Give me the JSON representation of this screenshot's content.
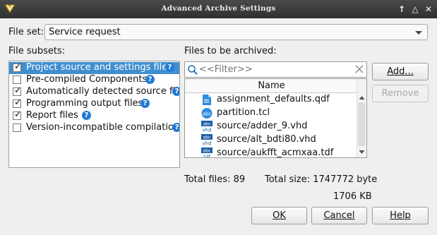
{
  "window": {
    "title": "Advanced Archive Settings"
  },
  "file_set": {
    "label": "File set:",
    "value": "Service request"
  },
  "subsets": {
    "label": "File subsets:",
    "items": [
      {
        "label": "Project source and settings files",
        "checked": true,
        "selected": true,
        "help": "?"
      },
      {
        "label": "Pre-compiled Components",
        "checked": false,
        "help": "?"
      },
      {
        "label": "Automatically detected source file",
        "checked": true,
        "help": "?"
      },
      {
        "label": "Programming output files",
        "checked": true,
        "help": "?"
      },
      {
        "label": "Report files",
        "checked": true,
        "help": "?"
      },
      {
        "label": "Version-incompatible compilation",
        "checked": false,
        "help": "?"
      }
    ]
  },
  "archive": {
    "label": "Files to be archived:",
    "filter_placeholder": "<<Filter>>",
    "column_name": "Name",
    "files": [
      {
        "name": "assignment_defaults.qdf",
        "icon": "document-icon"
      },
      {
        "name": "partition.tcl",
        "icon": "tcl-script-icon"
      },
      {
        "name": "source/adder_9.vhd",
        "icon": "vhd-file-icon"
      },
      {
        "name": "source/alt_bdti80.vhd",
        "icon": "vhd-file-icon"
      },
      {
        "name": "source/aukfft_acmxaa.tdf",
        "icon": "tdf-file-icon"
      }
    ]
  },
  "summary": {
    "total_files": "Total files: 89",
    "total_size": "Total size: 1747772 byte",
    "size_kb": "1706 KB"
  },
  "buttons": {
    "add": "Add...",
    "remove": "Remove",
    "ok": "OK",
    "cancel": "Cancel",
    "help": "Help"
  },
  "colors": {
    "selection": "#3f8ecf",
    "help_icon": "#1f7bd6",
    "titlebar": "#3a3a3a"
  }
}
